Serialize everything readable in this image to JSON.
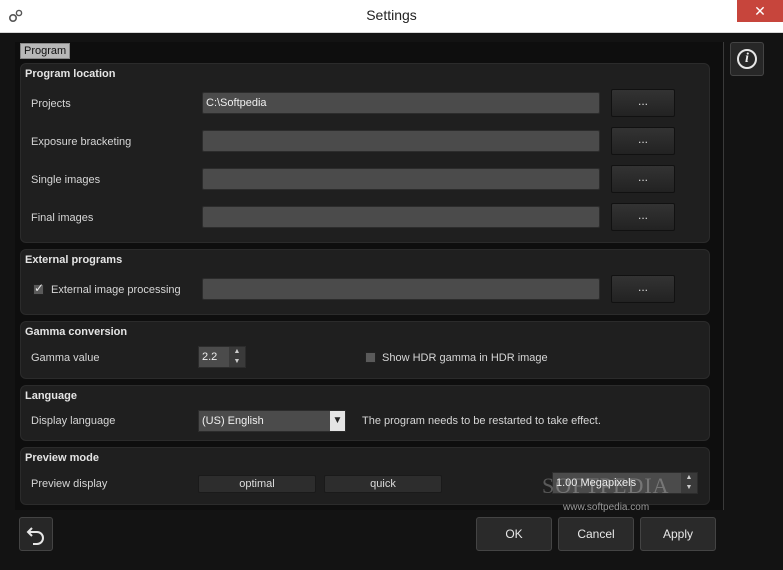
{
  "window": {
    "title": "Settings",
    "close_label": "✕"
  },
  "tabs": [
    {
      "label": "Program"
    }
  ],
  "program_location": {
    "title": "Program location",
    "rows": [
      {
        "label": "Projects",
        "value": "C:\\Softpedia",
        "button": "..."
      },
      {
        "label": "Exposure bracketing",
        "value": "",
        "button": "..."
      },
      {
        "label": "Single images",
        "value": "",
        "button": "..."
      },
      {
        "label": "Final images",
        "value": "",
        "button": "..."
      }
    ]
  },
  "external_programs": {
    "title": "External programs",
    "checkbox_label": "External image processing",
    "checked": true,
    "value": "",
    "button": "..."
  },
  "gamma": {
    "title": "Gamma conversion",
    "label": "Gamma value",
    "value": "2.2",
    "hdr_checkbox_label": "Show HDR gamma in HDR image",
    "hdr_checked": false
  },
  "language": {
    "title": "Language",
    "label": "Display language",
    "selected": "(US) English",
    "note": "The program needs to be restarted to take effect."
  },
  "preview": {
    "title": "Preview mode",
    "label": "Preview display",
    "option_optimal": "optimal",
    "option_quick": "quick",
    "megapixels": "1.00 Megapixels"
  },
  "watermark": {
    "text": "SOFTPEDIA",
    "url": "www.softpedia.com"
  },
  "footer": {
    "ok": "OK",
    "cancel": "Cancel",
    "apply": "Apply"
  },
  "icons": {
    "info": "info-icon",
    "undo": "undo-icon",
    "app": "gears-icon"
  }
}
